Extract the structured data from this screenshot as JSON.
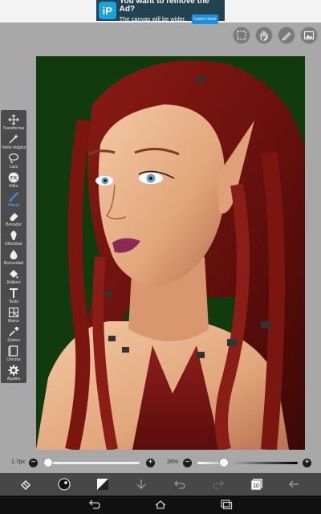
{
  "ad": {
    "logo_text": "iP",
    "title": "You want to remove the Ad?",
    "subtitle": "The canvas will be wider.",
    "button": "Learn more"
  },
  "top_tools": [
    "selection-icon",
    "hand-icon",
    "pen-icon",
    "image-icon"
  ],
  "toolbar": {
    "items": [
      {
        "label": "Transformar",
        "icon": "move-icon"
      },
      {
        "label": "Varita mágica",
        "icon": "magic-wand-icon"
      },
      {
        "label": "Lazo",
        "icon": "lasso-icon"
      },
      {
        "label": "Filtro",
        "icon": "fx-icon",
        "glyph": "FX"
      },
      {
        "label": "Pincel",
        "icon": "brush-icon",
        "active": true
      },
      {
        "label": "Borrador",
        "icon": "eraser-icon"
      },
      {
        "label": "Difuminar",
        "icon": "smudge-icon"
      },
      {
        "label": "Borrosidad",
        "icon": "blur-drop-icon"
      },
      {
        "label": "Relleno",
        "icon": "bucket-icon"
      },
      {
        "label": "Texto",
        "icon": "text-icon",
        "glyph": "T"
      },
      {
        "label": "Marco",
        "icon": "frame-icon"
      },
      {
        "label": "Gotero",
        "icon": "eyedropper-icon"
      },
      {
        "label": "Lienzos",
        "icon": "canvas-icon"
      },
      {
        "label": "Ajustes",
        "icon": "gear-icon"
      }
    ]
  },
  "sliders": {
    "size_label": "1.7px",
    "size_level": 0.05,
    "opacity_label": "26%",
    "opacity_level": 0.26
  },
  "bottombar": {
    "layers_count": "10",
    "icons": [
      "quick-menu-icon",
      "color-picker-icon",
      "color-swatch-icon",
      "download-icon",
      "undo-icon",
      "redo-icon",
      "layers-icon",
      "back-arrow-icon"
    ]
  },
  "colors": {
    "canvas_bg": "#123a0f",
    "accent": "#3b8cff",
    "toolbar_bg": "#4b4b4b"
  }
}
